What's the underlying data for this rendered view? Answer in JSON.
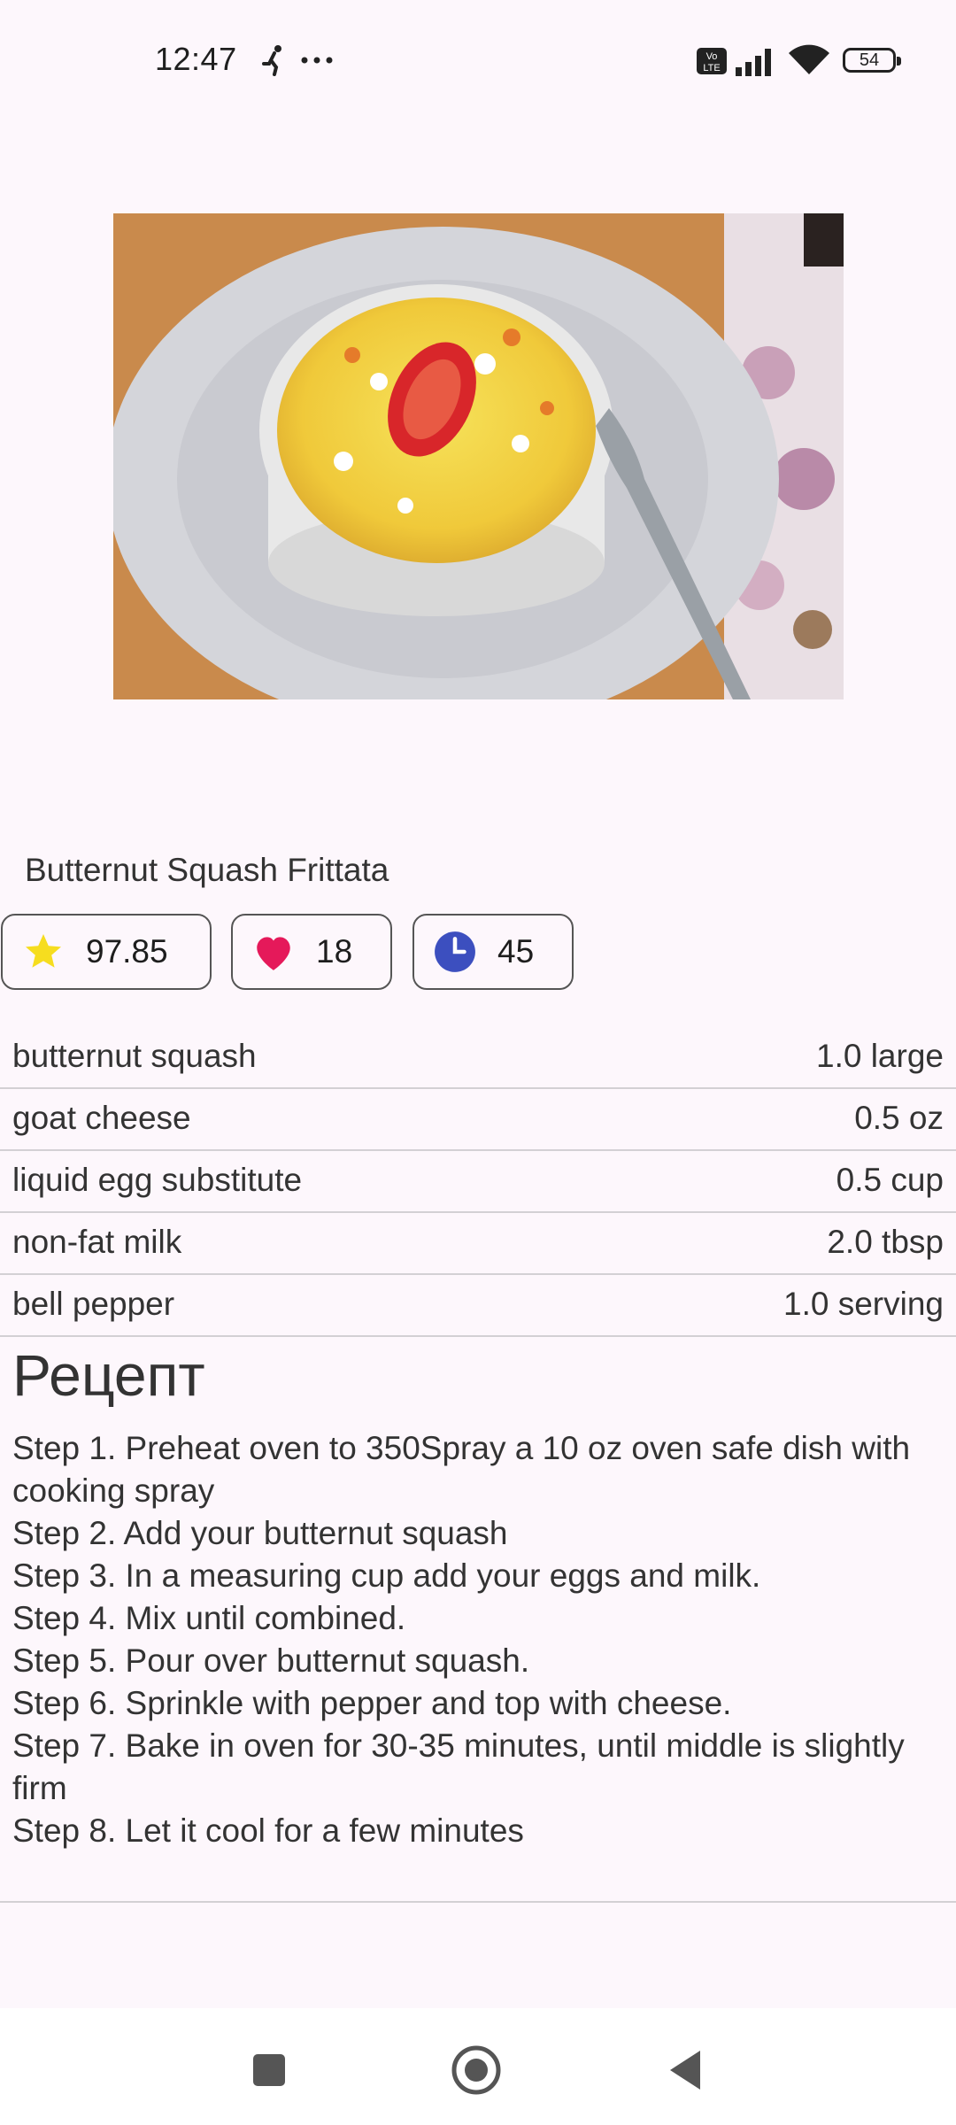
{
  "status": {
    "time": "12:47",
    "battery": "54",
    "icons": [
      "walk-icon",
      "more-dots-icon",
      "volte-icon",
      "signal-icon",
      "wifi-icon",
      "battery-icon"
    ]
  },
  "recipe": {
    "title": "Butternut Squash Frittata",
    "rating": "97.85",
    "likes": "18",
    "time": "45",
    "ingredients": [
      {
        "name": "butternut squash",
        "qty": "1.0 large"
      },
      {
        "name": "goat cheese",
        "qty": "0.5 oz"
      },
      {
        "name": "liquid egg substitute",
        "qty": "0.5 cup"
      },
      {
        "name": "non-fat milk",
        "qty": "2.0 tbsp"
      },
      {
        "name": "bell pepper",
        "qty": "1.0 serving"
      }
    ],
    "section_title": "Рецепт",
    "steps": [
      "Step 1. Preheat oven to 350Spray a 10 oz oven safe dish with cooking spray",
      "Step 2. Add your butternut squash",
      "Step 3. In a measuring cup add your eggs and milk.",
      "Step 4. Mix until combined.",
      "Step 5. Pour over butternut squash.",
      "Step 6. Sprinkle with pepper and top with cheese.",
      "Step 7. Bake in oven for 30-35 minutes, until middle is slightly firm",
      "Step 8. Let it cool for a few minutes"
    ]
  },
  "colors": {
    "background": "#fdf7fc",
    "star": "#f6dd1f",
    "heart": "#e5195a",
    "clock": "#3c4fbf"
  },
  "nav": {
    "icons": [
      "recents-square-icon",
      "home-circle-icon",
      "back-triangle-icon"
    ]
  }
}
